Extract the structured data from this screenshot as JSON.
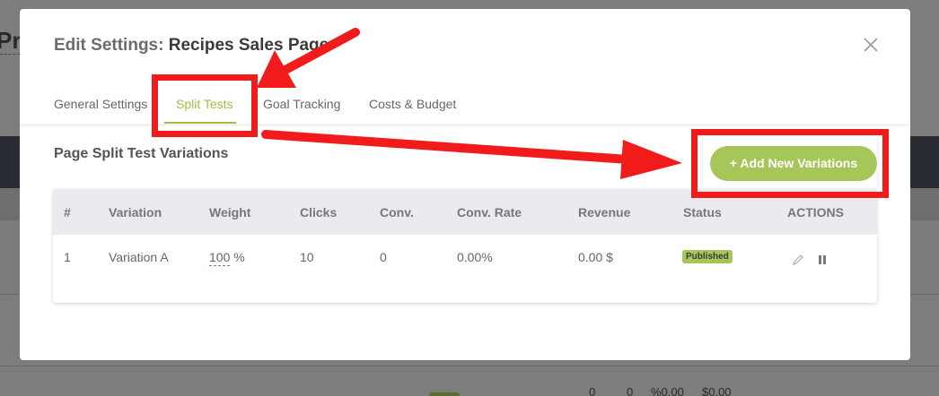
{
  "background": {
    "page_title": "Pr",
    "bottom_row": [
      "0",
      "0",
      "%0.00",
      "$0.00"
    ]
  },
  "modal": {
    "title_prefix": "Edit Settings:",
    "title_name": "Recipes Sales Page",
    "close_icon": "close-icon",
    "tabs": [
      {
        "label": "General Settings",
        "active": false
      },
      {
        "label": "Split Tests",
        "active": true
      },
      {
        "label": "Goal Tracking",
        "active": false
      },
      {
        "label": "Costs & Budget",
        "active": false
      }
    ],
    "section_title": "Page Split Test Variations",
    "add_button_label": "+ Add New Variations",
    "table": {
      "headers": [
        "#",
        "Variation",
        "Weight",
        "Clicks",
        "Conv.",
        "Conv. Rate",
        "Revenue",
        "Status",
        "ACTIONS"
      ],
      "rows": [
        {
          "index": "1",
          "variation": "Variation A",
          "weight": "100",
          "weight_unit": "%",
          "clicks": "10",
          "conv": "0",
          "conv_rate": "0.00%",
          "revenue": "0.00 $",
          "status": "Published",
          "actions": [
            "pencil-icon",
            "pause-icon"
          ]
        }
      ]
    }
  },
  "colors": {
    "accent": "#a6c659",
    "active_tab": "#9bbf45",
    "annotation_red": "#f21b1b",
    "overlay_dark_bar": "#272a30"
  }
}
